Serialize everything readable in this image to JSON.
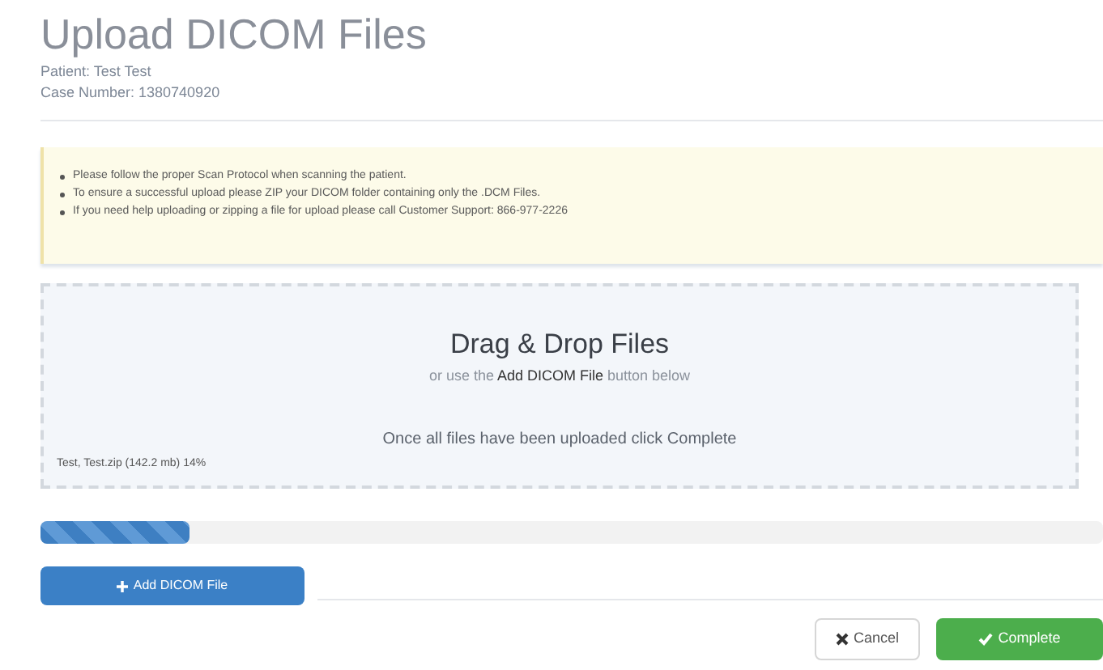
{
  "title": "Upload DICOM Files",
  "patient": {
    "label": "Patient:",
    "value": "Test Test"
  },
  "case_number": {
    "label": "Case Number:",
    "value": "1380740920"
  },
  "notices": [
    "Please follow the proper Scan Protocol when scanning the patient.",
    "To ensure a successful upload please ZIP your DICOM folder containing only the .DCM Files.",
    "If you need help uploading or zipping a file for upload please call Customer Support: 866-977-2226"
  ],
  "dropzone": {
    "heading": "Drag & Drop Files",
    "subheading": "or use the **Add DICOM File** button below",
    "instruction": "Once all files have been uploaded click Complete",
    "file_status": "Test, Test.zip (142.2 mb) 14%"
  },
  "progress": {
    "level": 0.14
  },
  "add_button": {
    "label": "Add DICOM File"
  },
  "buttons": [
    {
      "kind": "cancel",
      "label": "Cancel"
    },
    {
      "kind": "complete",
      "label": "Complete"
    }
  ]
}
